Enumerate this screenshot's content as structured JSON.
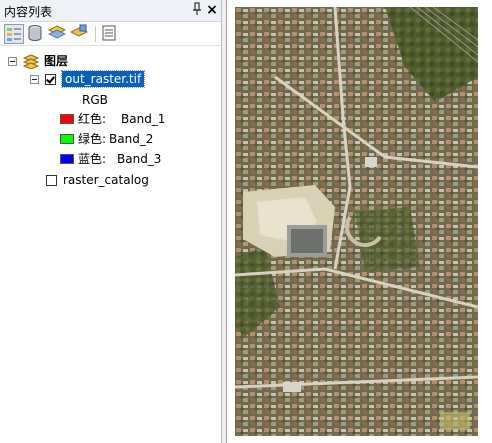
{
  "panel": {
    "title": "内容列表",
    "pin_icon": "pin-icon",
    "close_glyph": "×"
  },
  "toolbar": {
    "buttons": [
      {
        "name": "list-by-drawing-order",
        "icon": "drawing-order-icon",
        "active": true
      },
      {
        "name": "list-by-source",
        "icon": "source-icon",
        "active": false
      },
      {
        "name": "list-by-visibility",
        "icon": "visibility-icon",
        "active": false
      },
      {
        "name": "list-by-selection",
        "icon": "selection-icon",
        "active": false
      },
      {
        "name": "options",
        "icon": "options-icon",
        "active": false
      }
    ]
  },
  "tree": {
    "root_label": "图层",
    "layer1": {
      "name": "out_raster.tif",
      "checked": true,
      "renderer": "RGB",
      "bands": [
        {
          "label": "红色:",
          "band": "Band_1",
          "color": "#ff0000"
        },
        {
          "label": "绿色:",
          "band": "Band_2",
          "color": "#00ff00"
        },
        {
          "label": "蓝色:",
          "band": "Band_3",
          "color": "#0000ff"
        }
      ]
    },
    "layer2": {
      "name": "raster_catalog",
      "checked": false
    }
  },
  "colors": {
    "selection": "#0a5fbd",
    "panel_header": "#eef2f7"
  }
}
